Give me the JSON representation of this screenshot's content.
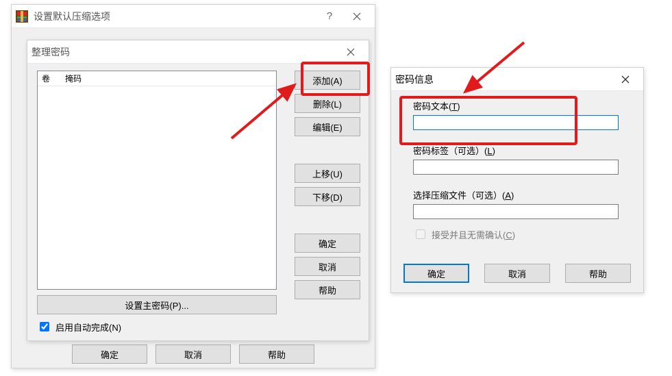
{
  "parent": {
    "title": "设置默认压缩选项",
    "ok": "确定",
    "cancel": "取消",
    "help": "帮助"
  },
  "organize": {
    "title": "整理密码",
    "col_vol": "卷",
    "col_mask": "掩码",
    "add": "添加(A)",
    "delete": "删除(L)",
    "edit": "编辑(E)",
    "up": "上移(U)",
    "down": "下移(D)",
    "ok": "确定",
    "cancel": "取消",
    "help": "帮助",
    "master": "设置主密码(P)...",
    "autocomplete": "启用自动完成(N)"
  },
  "pwinfo": {
    "title": "密码信息",
    "text_label_pre": "密码文本(",
    "text_label_u": "T",
    "text_label_post": ")",
    "tag_label_pre": "密码标签（可选）(",
    "tag_label_u": "L",
    "tag_label_post": ")",
    "archive_label_pre": "选择压缩文件（可选）(",
    "archive_label_u": "A",
    "archive_label_post": ")",
    "accept_pre": "接受并且无需确认(",
    "accept_u": "C",
    "accept_post": ")",
    "ok": "确定",
    "cancel": "取消",
    "help": "帮助",
    "text_value": "",
    "tag_value": "",
    "archive_value": ""
  }
}
